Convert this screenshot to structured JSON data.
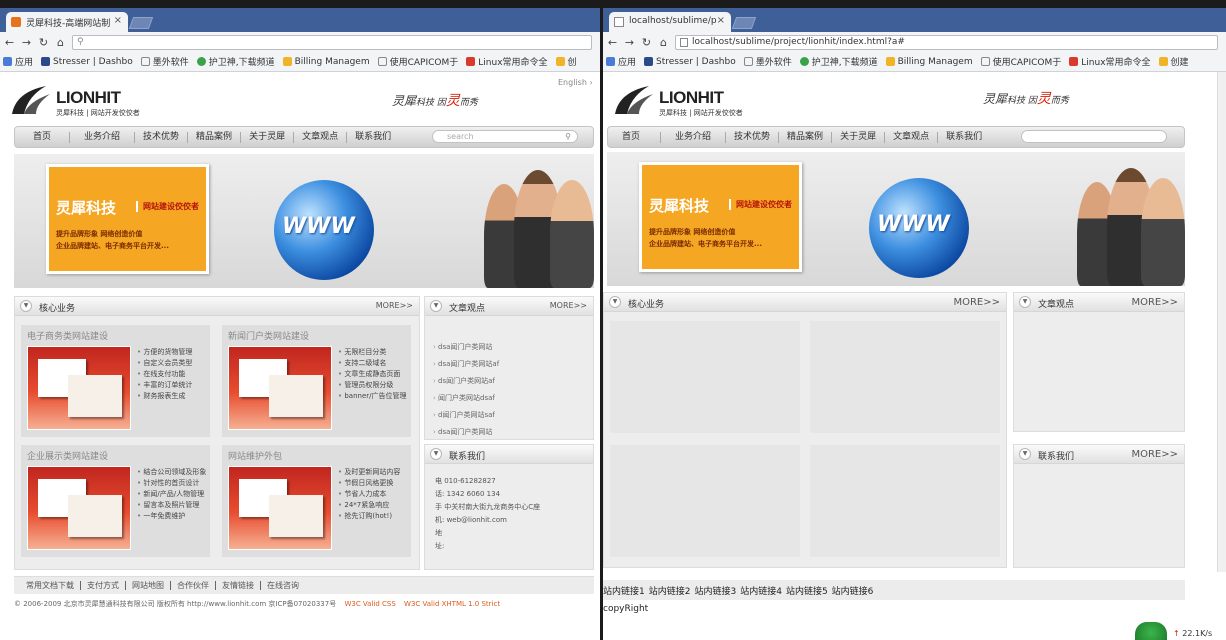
{
  "left": {
    "tab_title": "灵犀科技-高端网站制",
    "url": "",
    "bookmarks": [
      "应用",
      "Stresser | Dashbo",
      "墨外软件",
      "护卫神,下载频道",
      "Billing Managem",
      "使用CAPICOM于",
      "Linux常用命令全",
      "创"
    ],
    "logo": "LIONHIT",
    "logo_sub": "灵犀科技 | 网站开发佼佼者",
    "slogan_1": "灵犀",
    "slogan_2": "科技 因",
    "slogan_3": "灵",
    "slogan_4": "而秀",
    "english": "English",
    "nav": [
      "首页",
      "业务介绍",
      "技术优势",
      "精品案例",
      "关于灵犀",
      "文章观点",
      "联系我们"
    ],
    "search_placeholder": "search",
    "banner": {
      "title": "灵犀科技",
      "subtitle": "网站建设佼佼者",
      "line1": "提升品牌形象  网络创造价值",
      "line2": "企业品牌建站、电子商务平台开发...",
      "www": "WWW"
    },
    "core": {
      "title": "核心业务",
      "more": "MORE>>",
      "cards": [
        {
          "title": "电子商务类网站建设",
          "items": [
            "方便的货物管理",
            "自定义会员类型",
            "在线支付功能",
            "丰富的订单统计",
            "财务报表生成"
          ]
        },
        {
          "title": "新闻门户类网站建设",
          "items": [
            "无限栏目分类",
            "支持二级域名",
            "文章生成静态页面",
            "管理员权限分级",
            "banner/广告位管理"
          ]
        },
        {
          "title": "企业展示类网站建设",
          "items": [
            "结合公司领域及形象",
            "针对性的首页设计",
            "新闻/产品/人物管理",
            "留言本及照片管理",
            "一年免费维护"
          ]
        },
        {
          "title": "网站维护外包",
          "items": [
            "及时更新网站内容",
            "节假日风格更换",
            "节省人力成本",
            "24*7紧急响应",
            "抢先订购(hot!)"
          ]
        }
      ]
    },
    "articles": {
      "title": "文章观点",
      "more": "MORE>>",
      "items": [
        "dsa闻门户类网站",
        "dsa闻门户类网站af",
        "ds闻门户类网站af",
        "闻门户类网站dsaf",
        "d闻门户类网站saf",
        "dsa闻门户类网站"
      ]
    },
    "contact": {
      "title": "联系我们",
      "rows": [
        "电  010-61282827",
        "话: 1342 6060 134",
        "手  中关村南大街九龙商务中心C座",
        "机: web@lionhit.com",
        "地",
        "址:"
      ]
    },
    "footer_links": [
      "常用文档下载",
      "支付方式",
      "网站地图",
      "合作伙伴",
      "友情链接",
      "在线咨询"
    ],
    "copyright": "© 2006-2009 北京市灵犀慧通科技有限公司 版权所有 http://www.lionhit.com 京ICP备07020337号",
    "valid_css": "W3C Valid CSS",
    "valid_xhtml": "W3C Valid XHTML 1.0 Strict"
  },
  "right": {
    "tab_title": "localhost/sublime/p",
    "url": "localhost/sublime/project/lionhit/index.html?a#",
    "bookmarks": [
      "应用",
      "Stresser | Dashbo",
      "墨外软件",
      "护卫神,下载频道",
      "Billing Managem",
      "使用CAPICOM于",
      "Linux常用命令全",
      "创建"
    ],
    "logo": "LIONHIT",
    "logo_sub": "灵犀科技 | 网站开发佼佼者",
    "slogan_1": "灵犀",
    "slogan_2": "科技 因",
    "slogan_3": "灵",
    "slogan_4": "而秀",
    "nav": [
      "首页",
      "业务介绍",
      "技术优势",
      "精品案例",
      "关于灵犀",
      "文章观点",
      "联系我们"
    ],
    "banner": {
      "title": "灵犀科技",
      "subtitle": "网站建设佼佼者",
      "line1": "提升品牌形象  网络创造价值",
      "line2": "企业品牌建站、电子商务平台开发...",
      "www": "WWW"
    },
    "core": {
      "title": "核心业务",
      "more": "MORE>>"
    },
    "articles": {
      "title": "文章观点",
      "more": "MORE>>"
    },
    "contact": {
      "title": "联系我们",
      "more": "MORE>>"
    },
    "site_links": [
      "站内链接1",
      "站内链接2",
      "站内链接3",
      "站内链接4",
      "站内链接5",
      "站内链接6"
    ],
    "copyright": "copyRight",
    "net_speed": "22.1K/s"
  },
  "colors": {
    "brand_red": "#d81e06",
    "banner_orange": "#f5a623",
    "chrome_tab_bar": "#3f5f98"
  }
}
